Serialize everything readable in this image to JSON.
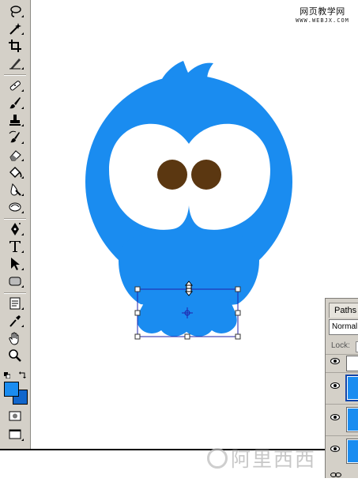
{
  "site_logo": {
    "cn": "网页教学网",
    "en": "WWW.WEBJX.COM"
  },
  "panel": {
    "tab_label": "Paths",
    "blend_mode": "Normal",
    "lock_label": "Lock:"
  },
  "colors": {
    "bird_blue": "#1a8cf0",
    "eye_white": "#ffffff",
    "pupil_brown": "#5b3711",
    "foreground_swatch": "#1a8cf0",
    "background_swatch": "#1166cc",
    "transform_box": "#2222aa"
  },
  "tools": [
    "lasso-icon",
    "magic-wand-icon",
    "crop-icon",
    "slice-icon",
    "healing-brush-icon",
    "brush-icon",
    "clone-stamp-icon",
    "history-brush-icon",
    "eraser-icon",
    "paint-bucket-icon",
    "blur-icon",
    "dodge-icon",
    "pen-icon",
    "type-icon",
    "path-selection-icon",
    "rectangle-shape-icon",
    "notes-icon",
    "eyedropper-icon",
    "hand-icon",
    "zoom-icon"
  ],
  "watermark": "阿里西西"
}
